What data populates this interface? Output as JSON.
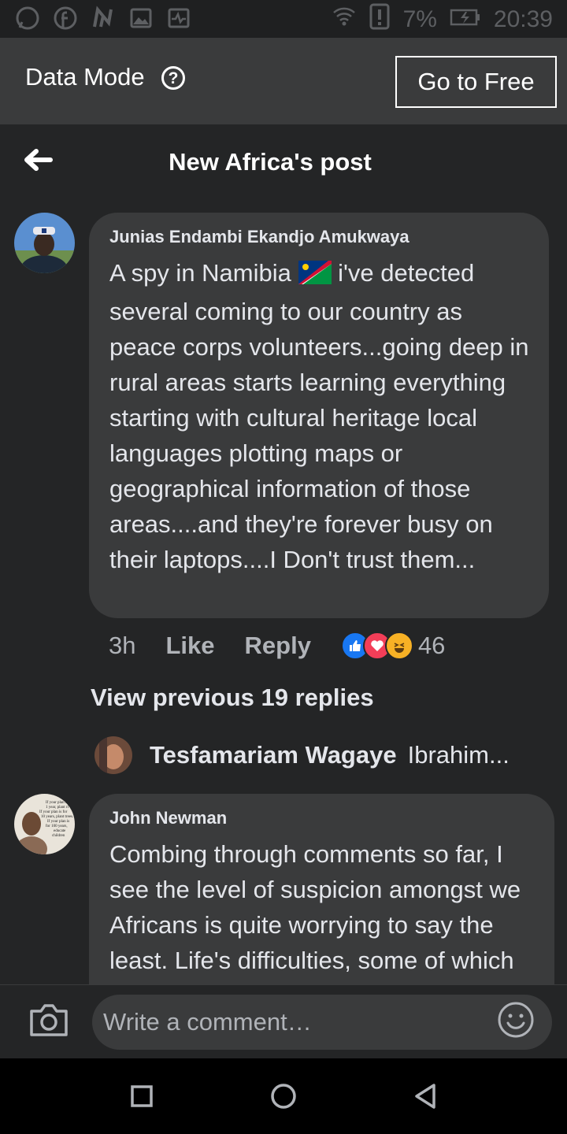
{
  "status_bar": {
    "icons": [
      "whatsapp-icon",
      "facebook-icon",
      "n-icon",
      "gallery-icon",
      "activity-icon"
    ],
    "battery": "7%",
    "time": "20:39"
  },
  "data_mode": {
    "label": "Data Mode",
    "help_icon": "question-icon",
    "button_label": "Go to Free"
  },
  "header": {
    "title": "New Africa's post",
    "back_icon": "back-arrow-icon"
  },
  "comments": [
    {
      "author": "Junias Endambi Ekandjo Amukwaya",
      "text_before_flag": "A spy in Namibia ",
      "flag": "namibia-flag",
      "text": " i've detected several coming to our country as peace corps volunteers...going deep in rural areas starts learning everything starting with cultural heritage local languages plotting maps or geographical information of those areas....and they're forever busy on their laptops....I Don't trust them...",
      "time": "3h",
      "like_label": "Like",
      "reply_label": "Reply",
      "reactions": [
        "like",
        "love",
        "haha"
      ],
      "reaction_count": "46"
    },
    {
      "author": "John Newman",
      "text": "Combing through comments so far, I see the level of suspicion amongst we Africans is quite worrying to say the least. Life's difficulties, some of which are self inflicted have left"
    }
  ],
  "view_previous": "View previous 19 replies",
  "reply_preview": {
    "name": "Tesfamariam Wagaye",
    "text": "Ibrahim..."
  },
  "avatar_image_text": [
    "If your plan is",
    "1 year, plant ri",
    "If your plan is for",
    "10 years, plant trees.",
    "If your plan is",
    "for 100 years,",
    "educate",
    "children"
  ],
  "composer": {
    "placeholder": "Write a comment…"
  },
  "colors": {
    "background": "#242526",
    "bubble": "#3a3b3c",
    "like_blue": "#1877f2",
    "love_red": "#f33e58",
    "haha_yellow": "#f7b125"
  }
}
